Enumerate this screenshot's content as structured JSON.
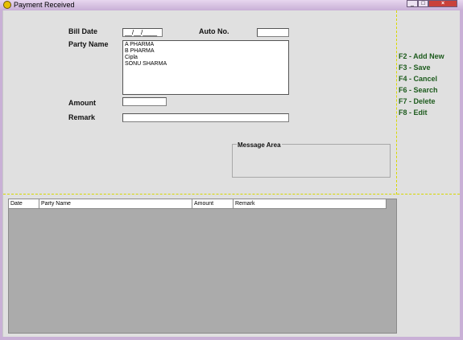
{
  "window": {
    "title": "Payment Received",
    "minimize_glyph": "_",
    "maximize_glyph": "□",
    "close_glyph": "×"
  },
  "form": {
    "bill_date_label": "Bill Date",
    "bill_date_value": "__/__/____",
    "auto_no_label": "Auto No.",
    "auto_no_value": "",
    "party_name_label": "Party Name",
    "party_names": [
      "A PHARMA",
      "B PHARMA",
      "Cipla",
      "SONU SHARMA"
    ],
    "amount_label": "Amount",
    "amount_value": "",
    "remark_label": "Remark",
    "remark_value": ""
  },
  "message_area": {
    "title": "Message Area",
    "text": ""
  },
  "shortcuts": [
    "F2 - Add New",
    "F3 - Save",
    "F4 - Cancel",
    "F6 - Search",
    "F7 - Delete",
    "F8 - Edit"
  ],
  "grid": {
    "columns": [
      "Date",
      "Party Name",
      "Amount",
      "Remark"
    ],
    "rows": []
  },
  "colors": {
    "shortcut_text": "#1d5b1d",
    "guide_lines": "#d8d800",
    "grid_background": "#ababab"
  }
}
